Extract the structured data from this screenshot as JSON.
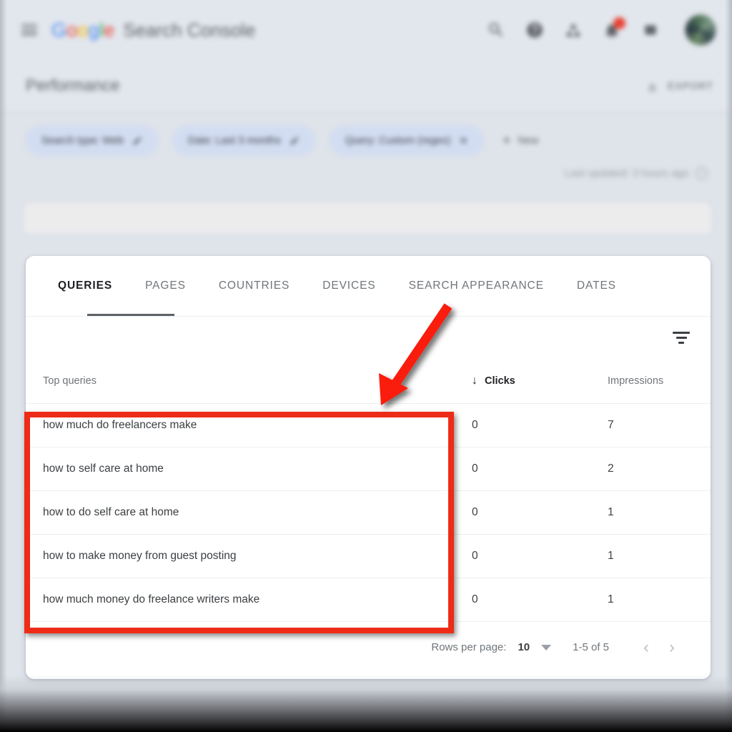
{
  "topbar": {
    "menu_icon": "hamburger-icon",
    "brand_google": "Google",
    "brand_product": "Search Console",
    "icons": [
      {
        "name": "search-icon",
        "label": "Search"
      },
      {
        "name": "help-icon",
        "label": "Help"
      },
      {
        "name": "apps-share-icon",
        "label": "Share"
      },
      {
        "name": "notifications-bell-icon",
        "label": "Notifications"
      },
      {
        "name": "app-grid-icon",
        "label": "Google apps"
      }
    ],
    "notification_badge": "",
    "avatar_label": "Account"
  },
  "header": {
    "page_title": "Performance",
    "export_label": "EXPORT"
  },
  "filters": {
    "chips": [
      {
        "label": "Search type: Web",
        "action": "edit"
      },
      {
        "label": "Date: Last 3 months",
        "action": "edit"
      },
      {
        "label": "Query: Custom (regex)",
        "action": "remove"
      }
    ],
    "new_filter_label": "New",
    "last_updated": "Last updated: 3 hours ago"
  },
  "card": {
    "tabs": [
      {
        "label": "QUERIES",
        "active": true
      },
      {
        "label": "PAGES",
        "active": false
      },
      {
        "label": "COUNTRIES",
        "active": false
      },
      {
        "label": "DEVICES",
        "active": false
      },
      {
        "label": "SEARCH APPEARANCE",
        "active": false
      },
      {
        "label": "DATES",
        "active": false
      }
    ],
    "filter_icon_name": "filter-list-icon",
    "table": {
      "headers": {
        "query": "Top queries",
        "clicks": "Clicks",
        "clicks_sort_arrow": "↓",
        "impressions": "Impressions"
      },
      "rows": [
        {
          "query": "how much do freelancers make",
          "clicks": "0",
          "impressions": "7"
        },
        {
          "query": "how to self care at home",
          "clicks": "0",
          "impressions": "2"
        },
        {
          "query": "how to do self care at home",
          "clicks": "0",
          "impressions": "1"
        },
        {
          "query": "how to make money from guest posting",
          "clicks": "0",
          "impressions": "1"
        },
        {
          "query": "how much money do freelance writers make",
          "clicks": "0",
          "impressions": "1"
        }
      ]
    },
    "pagination": {
      "rows_per_page_label": "Rows per page:",
      "rows_per_page_value": "10",
      "range": "1-5 of 5",
      "prev": "‹",
      "next": "›"
    }
  },
  "annotations": {
    "highlight_color": "#ee2b17",
    "arrow_color": "#fa1e0e",
    "arrow_target": "top-queries-column"
  },
  "colors": {
    "clicks_value": "#4285f4",
    "impressions_value": "#9334b7",
    "background": "#dfe3ea",
    "card": "#ffffff",
    "active_tab": "#202124"
  }
}
